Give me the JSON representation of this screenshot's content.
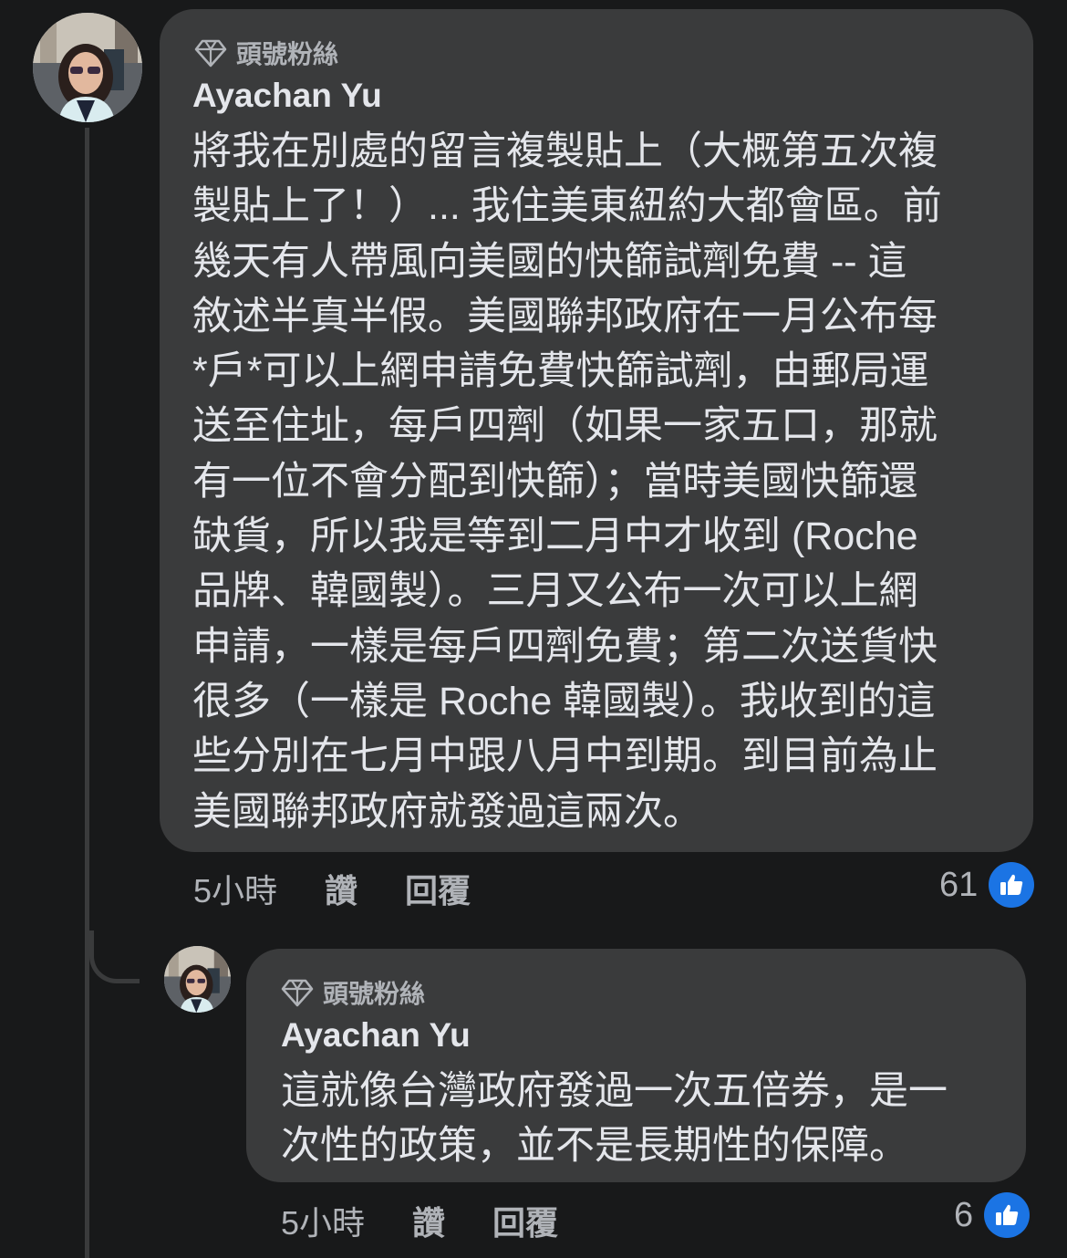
{
  "comments": [
    {
      "badge": "頭號粉絲",
      "author": "Ayachan Yu",
      "text": "將我在別處的留言複製貼上（大概第五次複\n製貼上了！）... 我住美東紐約大都會區。前\n幾天有人帶風向美國的快篩試劑免費 -- 這\n敘述半真半假。美國聯邦政府在一月公布每\n*戶*可以上網申請免費快篩試劑，由郵局運\n送至住址，每戶四劑（如果一家五口，那就\n有一位不會分配到快篩）；當時美國快篩還\n缺貨，所以我是等到二月中才收到 (Roche\n品牌、韓國製）。三月又公布一次可以上網\n申請，一樣是每戶四劑免費；第二次送貨快\n很多（一樣是 Roche 韓國製）。我收到的這\n些分別在七月中跟八月中到期。到目前為止\n美國聯邦政府就發過這兩次。",
      "time": "5小時",
      "like_label": "讚",
      "reply_label": "回覆",
      "like_count": "61"
    },
    {
      "badge": "頭號粉絲",
      "author": "Ayachan Yu",
      "text": "這就像台灣政府發過一次五倍券，是一\n次性的政策，並不是長期性的保障。",
      "time": "5小時",
      "like_label": "讚",
      "reply_label": "回覆",
      "like_count": "6"
    }
  ],
  "icons": {
    "badge": "diamond-icon",
    "reaction": "thumbs-up-icon",
    "avatar": "profile-photo"
  },
  "colors": {
    "background": "#18191a",
    "bubble": "#3a3b3c",
    "primary_text": "#e4e6eb",
    "secondary_text": "#b0b3b8",
    "like_blue": "#1b74e4"
  }
}
